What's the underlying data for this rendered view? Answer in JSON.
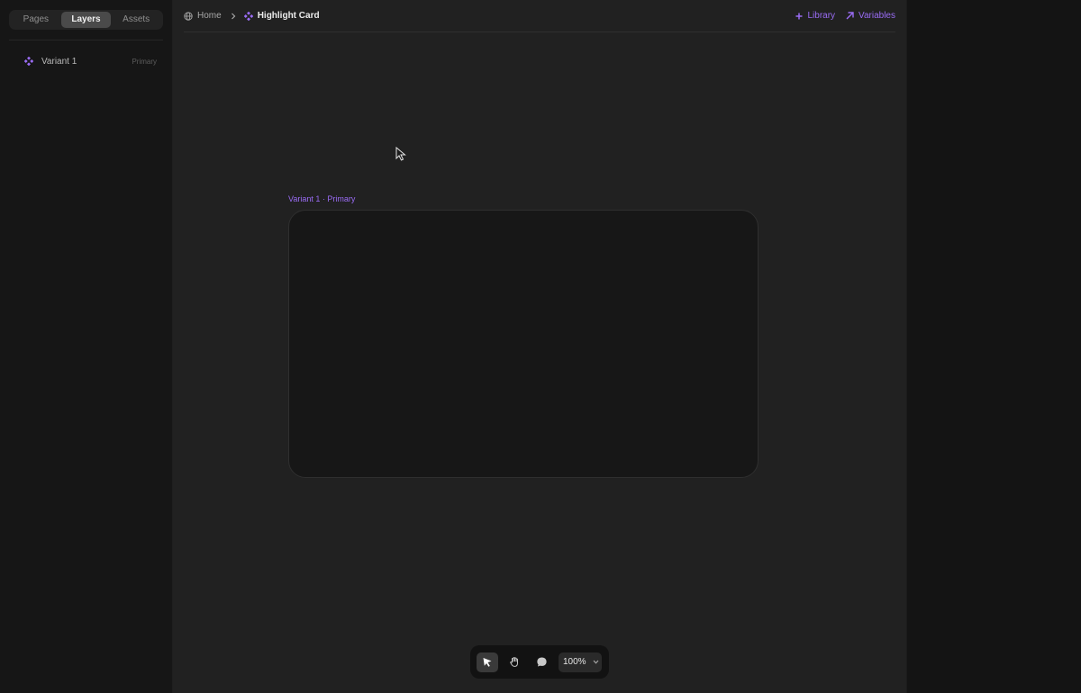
{
  "sidebar": {
    "tabs": [
      {
        "label": "Pages"
      },
      {
        "label": "Layers"
      },
      {
        "label": "Assets"
      }
    ],
    "active_tab": "Layers",
    "layers": [
      {
        "name": "Variant 1",
        "tag": "Primary",
        "icon": "component-icon"
      }
    ]
  },
  "breadcrumb": {
    "home": {
      "label": "Home",
      "icon": "globe-icon"
    },
    "current": {
      "label": "Highlight Card",
      "icon": "component-icon"
    }
  },
  "actions": {
    "library": {
      "label": "Library",
      "icon": "plus-icon"
    },
    "variables": {
      "label": "Variables",
      "icon": "arrow-up-right-icon"
    }
  },
  "canvas": {
    "frame_label": "Variant 1 · Primary"
  },
  "toolbar": {
    "tools": [
      {
        "name": "select",
        "icon": "pointer-icon",
        "active": true
      },
      {
        "name": "hand",
        "icon": "hand-icon",
        "active": false
      },
      {
        "name": "comment",
        "icon": "comment-icon",
        "active": false
      }
    ],
    "zoom": "100%"
  },
  "colors": {
    "accent": "#9a6cf5",
    "canvas_bg": "#212121",
    "sidebar_bg": "#161616",
    "frame_bg": "#171717"
  }
}
